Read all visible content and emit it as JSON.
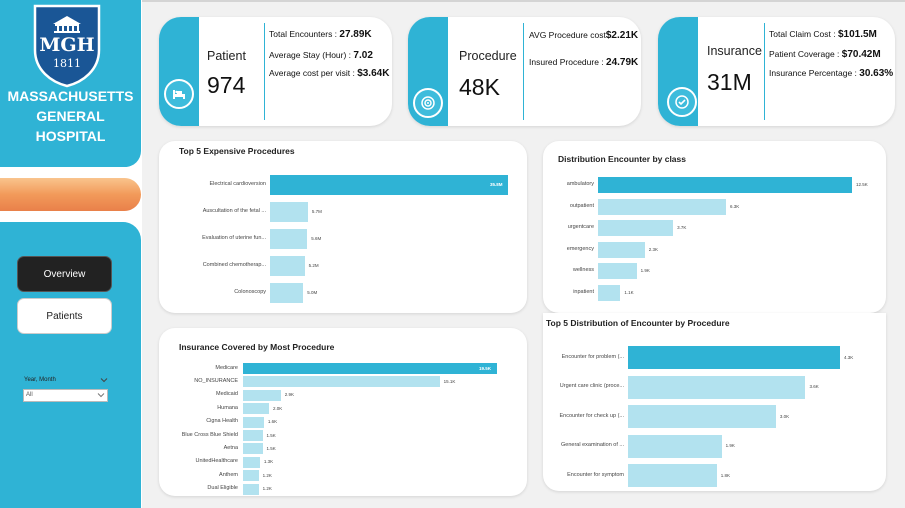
{
  "colors": {
    "accent": "#2fb3d5",
    "bar_highlight": "#2fb3d5",
    "bar_light": "#b2e2ef",
    "active_nav": "#222222",
    "orange": "#f29a5a"
  },
  "sidebar": {
    "logo": {
      "abbr": "MGH",
      "year": "1811"
    },
    "hospital_name": [
      "MASSACHUSETTS",
      "GENERAL",
      "HOSPITAL"
    ],
    "nav": [
      {
        "label": "Overview",
        "active": true
      },
      {
        "label": "Patients",
        "active": false
      }
    ],
    "slicer": {
      "label": "Year, Month",
      "value": "All"
    }
  },
  "kpis": {
    "patient": {
      "title": "Patient",
      "value": "974",
      "icon": "hospital-bed-icon",
      "rows": [
        {
          "label": "Total Encounters : ",
          "value": "27.89K"
        },
        {
          "label": "Average Stay (Hour) : ",
          "value": "7.02"
        },
        {
          "label": "Average cost per visit : ",
          "value": "$3.64K"
        }
      ]
    },
    "procedure": {
      "title": "Procedure",
      "value": "48K",
      "icon": "target-icon",
      "rows": [
        {
          "label": "AVG Procedure cost",
          "value": "$2.21K"
        },
        {
          "label": "Insured Procedure : ",
          "value": "24.79K"
        }
      ]
    },
    "insurance": {
      "title": "Insurance",
      "value": "31M",
      "icon": "check-badge-icon",
      "rows": [
        {
          "label": "Total Claim Cost  : ",
          "value": "$101.5M"
        },
        {
          "label": "Patient Coverage : ",
          "value": "$70.42M"
        },
        {
          "label": "Insurance Percentage : ",
          "value": "30.63%"
        }
      ]
    }
  },
  "chart_data": [
    {
      "id": "expensive",
      "type": "bar",
      "orientation": "horizontal",
      "title": "Top 5 Expensive Procedures",
      "categories": [
        "Electrical cardioversion",
        "Auscultation of the fetal ...",
        "Evaluation of uterine fun...",
        "Combined chemotherap...",
        "Colonoscopy"
      ],
      "values": [
        35.8,
        5.7,
        5.6,
        5.2,
        5.0
      ],
      "labels": [
        "35.8M",
        "5.7M",
        "5.6M",
        "5.2M",
        "5.0M"
      ],
      "unit": "M",
      "xlim": [
        0,
        35.8
      ],
      "highlight": 0
    },
    {
      "id": "class",
      "type": "bar",
      "orientation": "horizontal",
      "title": "Distribution Encounter by class",
      "categories": [
        "ambulatory",
        "outpatient",
        "urgentcare",
        "emergency",
        "wellness",
        "inpatient"
      ],
      "values": [
        12.5,
        6.3,
        3.7,
        2.3,
        1.9,
        1.1
      ],
      "labels": [
        "12.5K",
        "6.3K",
        "3.7K",
        "2.3K",
        "1.9K",
        "1.1K"
      ],
      "unit": "K",
      "xlim": [
        0,
        12.5
      ],
      "highlight": 0
    },
    {
      "id": "insurance",
      "type": "bar",
      "orientation": "horizontal",
      "title": "Insurance Covered by Most Procedure",
      "categories": [
        "Medicare",
        "NO_INSURANCE",
        "Medicaid",
        "Humana",
        "Cigna Health",
        "Blue Cross Blue Shield",
        "Aetna",
        "UnitedHealthcare",
        "Anthem",
        "Dual Eligible"
      ],
      "values": [
        19.5,
        15.1,
        2.9,
        2.0,
        1.6,
        1.5,
        1.5,
        1.3,
        1.2,
        1.2
      ],
      "labels": [
        "19.5K",
        "15.1K",
        "2.9K",
        "2.0K",
        "1.6K",
        "1.5K",
        "1.5K",
        "1.3K",
        "1.2K",
        "1.2K"
      ],
      "unit": "K",
      "xlim": [
        0,
        19.5
      ],
      "highlight": 0
    },
    {
      "id": "enc_proc",
      "type": "bar",
      "orientation": "horizontal",
      "title": "Top 5 Distribution of Encounter by Procedure",
      "categories": [
        "Encounter for problem (...",
        "Urgent care clinic (proce...",
        "Encounter for check up (...",
        "General examination of ...",
        "Encounter for symptom"
      ],
      "values": [
        4.3,
        3.6,
        3.0,
        1.9,
        1.8
      ],
      "labels": [
        "4.3K",
        "3.6K",
        "3.0K",
        "1.9K",
        "1.8K"
      ],
      "unit": "K",
      "xlim": [
        0,
        4.3
      ],
      "highlight": 0
    }
  ]
}
